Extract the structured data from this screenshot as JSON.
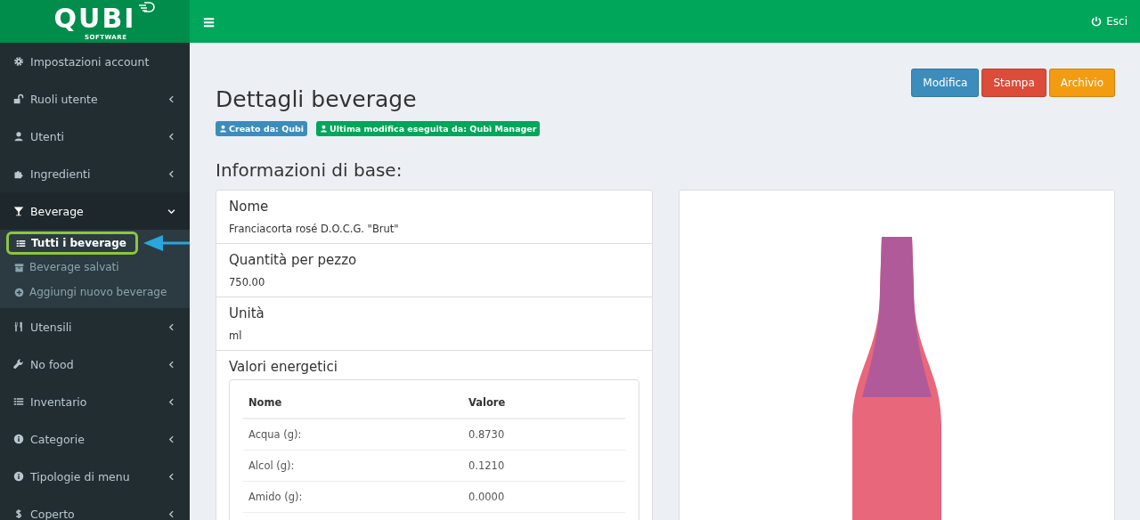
{
  "logo": {
    "name": "QUBI",
    "tagline": "SOFTWARE"
  },
  "header": {
    "menu_toggle": "≡",
    "logout": "Esci"
  },
  "sidebar": {
    "items": [
      {
        "label": "Impostazioni account",
        "expandable": false,
        "expanded": false
      },
      {
        "label": "Ruoli utente",
        "expandable": true,
        "expanded": false
      },
      {
        "label": "Utenti",
        "expandable": true,
        "expanded": false
      },
      {
        "label": "Ingredienti",
        "expandable": true,
        "expanded": false
      },
      {
        "label": "Beverage",
        "expandable": true,
        "expanded": true,
        "children": [
          {
            "label": "Tutti i beverage",
            "selected": true,
            "highlighted": true
          },
          {
            "label": "Beverage salvati",
            "selected": false,
            "highlighted": false
          },
          {
            "label": "Aggiungi nuovo beverage",
            "selected": false,
            "highlighted": false
          }
        ]
      },
      {
        "label": "Utensili",
        "expandable": true,
        "expanded": false
      },
      {
        "label": "No food",
        "expandable": true,
        "expanded": false
      },
      {
        "label": "Inventario",
        "expandable": true,
        "expanded": false
      },
      {
        "label": "Categorie",
        "expandable": true,
        "expanded": false
      },
      {
        "label": "Tipologie di menu",
        "expandable": true,
        "expanded": false
      },
      {
        "label": "Coperto",
        "expandable": true,
        "expanded": false
      }
    ]
  },
  "page": {
    "title": "Dettagli beverage",
    "buttons": [
      {
        "label": "Modifica",
        "color": "#3c8dbc"
      },
      {
        "label": "Stampa",
        "color": "#dd4b39"
      },
      {
        "label": "Archivio",
        "color": "#f39c12"
      }
    ],
    "badges": [
      {
        "label": "Creato da: Qubi",
        "color": "#3c8dbc"
      },
      {
        "label": "Ultima modifica eseguita da: Qubì Manager",
        "color": "#00a65a"
      }
    ],
    "section_title": "Informazioni di base:",
    "fields": [
      {
        "label": "Nome",
        "value": "Franciacorta rosé D.O.C.G. \"Brut\""
      },
      {
        "label": "Quantità per pezzo",
        "value": "750.00"
      },
      {
        "label": "Unità",
        "value": "ml"
      }
    ],
    "nutrition": {
      "title": "Valori energetici",
      "columns": [
        "Nome",
        "Valore"
      ],
      "rows": [
        [
          "Acqua (g):",
          "0.8730"
        ],
        [
          "Alcol (g):",
          "0.1210"
        ],
        [
          "Amido (g):",
          "0.0000"
        ]
      ]
    }
  }
}
